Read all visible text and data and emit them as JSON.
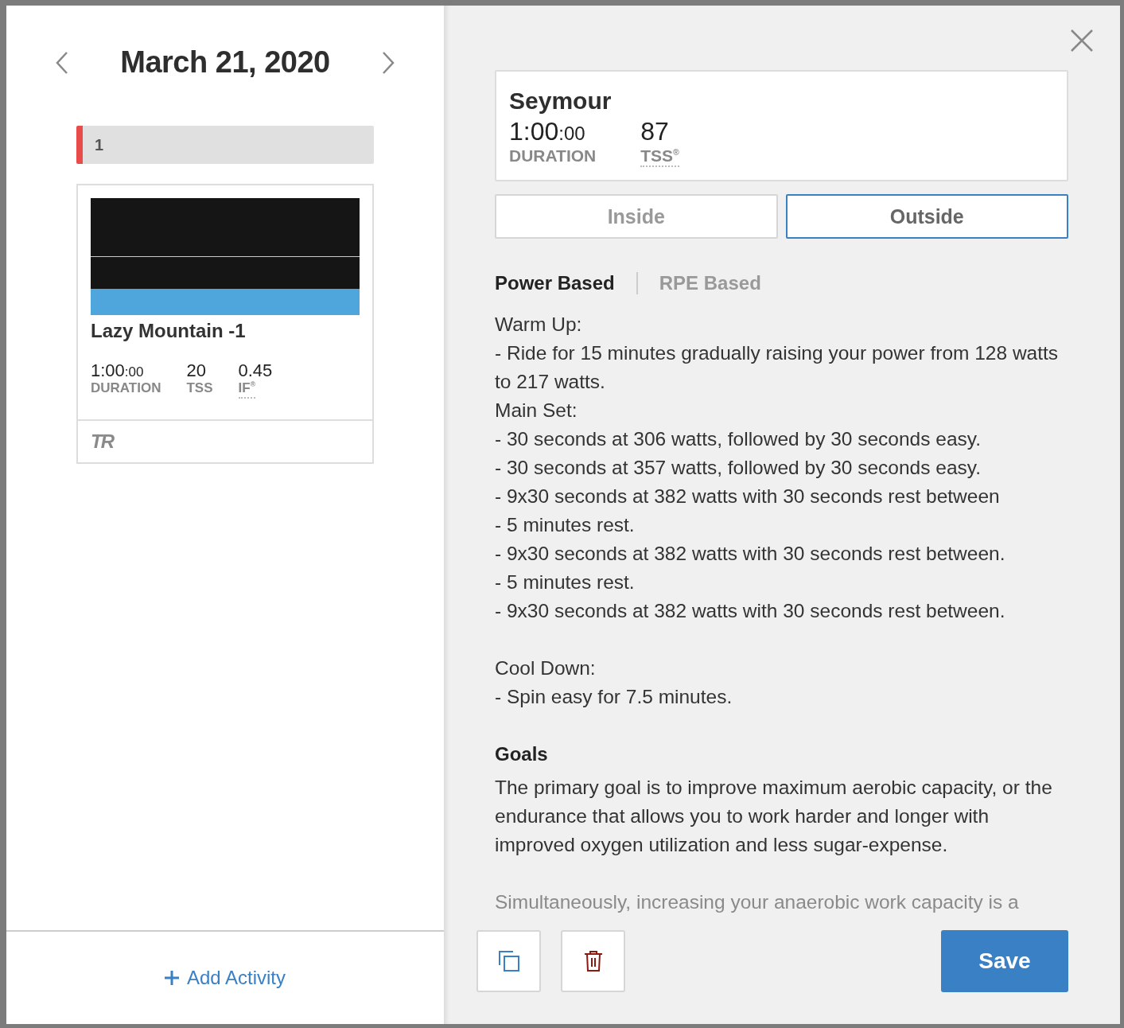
{
  "date_nav": {
    "title": "March 21, 2020"
  },
  "day_note": {
    "label": "1"
  },
  "workout_card": {
    "name": "Lazy Mountain -1",
    "badge": "TR",
    "stats": [
      {
        "value": "1:00",
        "suffix": ":00",
        "label": "DURATION",
        "kind": "plain"
      },
      {
        "value": "20",
        "label": "TSS",
        "kind": "plain"
      },
      {
        "value": "0.45",
        "label": "IF$^{®}$",
        "kind": "term"
      }
    ]
  },
  "add_activity": {
    "label": "Add Activity"
  },
  "detail": {
    "name": "Seymour",
    "stats": [
      {
        "value": "1:00",
        "suffix": ":00",
        "label": "DURATION",
        "kind": "plain"
      },
      {
        "value": "87",
        "label": "TSS$^{®}$",
        "kind": "term"
      }
    ]
  },
  "location_toggle": [
    {
      "label": "Inside",
      "selected": false
    },
    {
      "label": "Outside",
      "selected": true
    }
  ],
  "instruction_tabs": [
    {
      "label": "Power Based",
      "selected": true
    },
    {
      "label": "RPE Based",
      "selected": false
    }
  ],
  "instruction_blocks": [
    [
      "Warm Up:",
      "- Ride for 15 minutes gradually raising your power from 128 watts to 217 watts.",
      "Main Set:",
      "- 30 seconds at 306 watts, followed by 30 seconds easy.",
      "- 30 seconds at 357 watts, followed by 30 seconds easy.",
      "- 9x30 seconds at 382 watts with 30 seconds rest between",
      "- 5 minutes rest.",
      "- 9x30 seconds at 382 watts with 30 seconds rest between.",
      "- 5 minutes rest.",
      "- 9x30 seconds at 382 watts with 30 seconds rest between."
    ],
    [
      "Cool Down:",
      "- Spin easy for 7.5 minutes."
    ]
  ],
  "goals": {
    "heading": "Goals",
    "paragraphs": [
      "The primary goal is to improve maximum aerobic capacity, or the endurance that allows you to work harder and longer with improved oxygen utilization and less sugar-expense.",
      "Simultaneously, increasing your anaerobic work capacity is a"
    ]
  },
  "save": {
    "label": "Save"
  }
}
